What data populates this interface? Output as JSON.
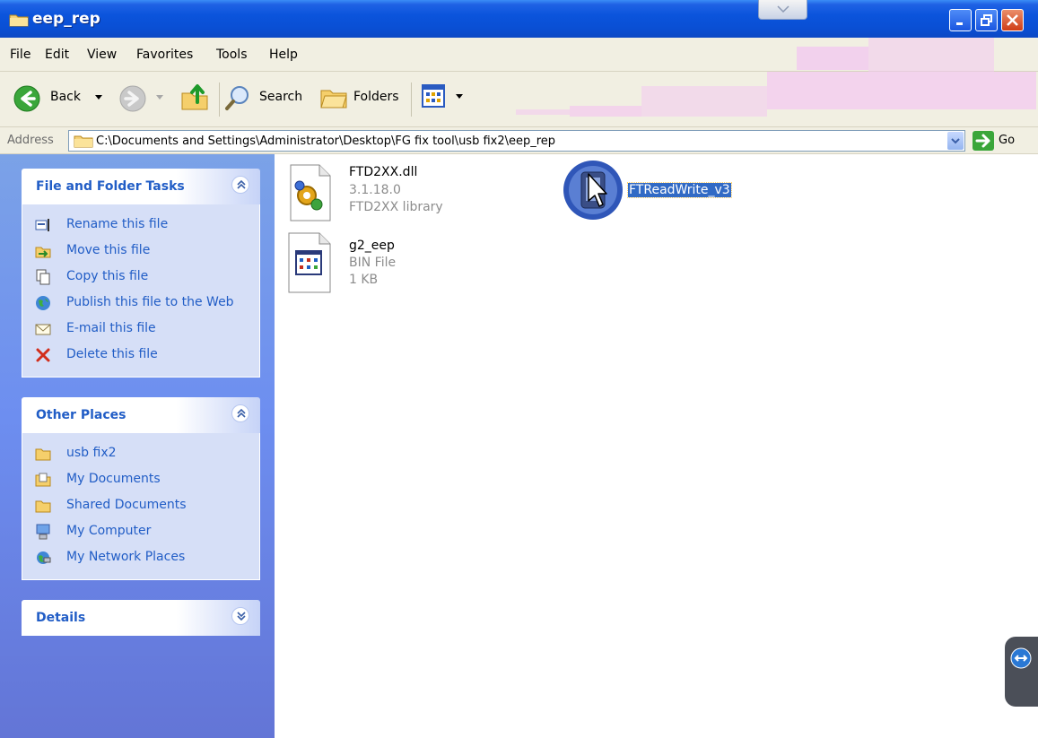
{
  "window": {
    "title": "eep_rep",
    "icons": {
      "folder": "folder-icon",
      "minimize": "minimize-icon",
      "maximize": "restore-icon",
      "close": "close-icon"
    }
  },
  "menu": {
    "items": [
      "File",
      "Edit",
      "View",
      "Favorites",
      "Tools",
      "Help"
    ]
  },
  "toolbar": {
    "back_label": "Back",
    "search_label": "Search",
    "folders_label": "Folders"
  },
  "address": {
    "label": "Address",
    "value": "C:\\Documents and Settings\\Administrator\\Desktop\\FG fix tool\\usb fix2\\eep_rep",
    "go_label": "Go"
  },
  "tasks_panel": {
    "title": "File and Folder Tasks",
    "items": [
      {
        "label": "Rename this file",
        "icon": "rename-icon"
      },
      {
        "label": "Move this file",
        "icon": "move-icon"
      },
      {
        "label": "Copy this file",
        "icon": "copy-icon"
      },
      {
        "label": "Publish this file to the Web",
        "icon": "globe-icon"
      },
      {
        "label": "E-mail this file",
        "icon": "envelope-icon"
      },
      {
        "label": "Delete this file",
        "icon": "delete-x-icon"
      }
    ]
  },
  "places_panel": {
    "title": "Other Places",
    "items": [
      {
        "label": "usb fix2",
        "icon": "folder-icon"
      },
      {
        "label": "My Documents",
        "icon": "documents-folder-icon"
      },
      {
        "label": "Shared Documents",
        "icon": "folder-icon"
      },
      {
        "label": "My Computer",
        "icon": "computer-icon"
      },
      {
        "label": "My Network Places",
        "icon": "network-icon"
      }
    ]
  },
  "details_panel": {
    "title": "Details"
  },
  "files": [
    {
      "name": "FTD2XX.dll",
      "line2": "3.1.18.0",
      "line3": "FTD2XX library",
      "icon": "dll-gear-icon"
    },
    {
      "name": "g2_eep",
      "line2": "BIN File",
      "line3": "1 KB",
      "icon": "bin-file-icon"
    },
    {
      "name": "FTReadWrite_v3",
      "icon": "application-icon",
      "selected": true
    }
  ],
  "colors": {
    "titlebar": "#0b54dc",
    "taskpane": "#6d8ef0",
    "task_link": "#215dc6",
    "selection": "#316ac5"
  }
}
